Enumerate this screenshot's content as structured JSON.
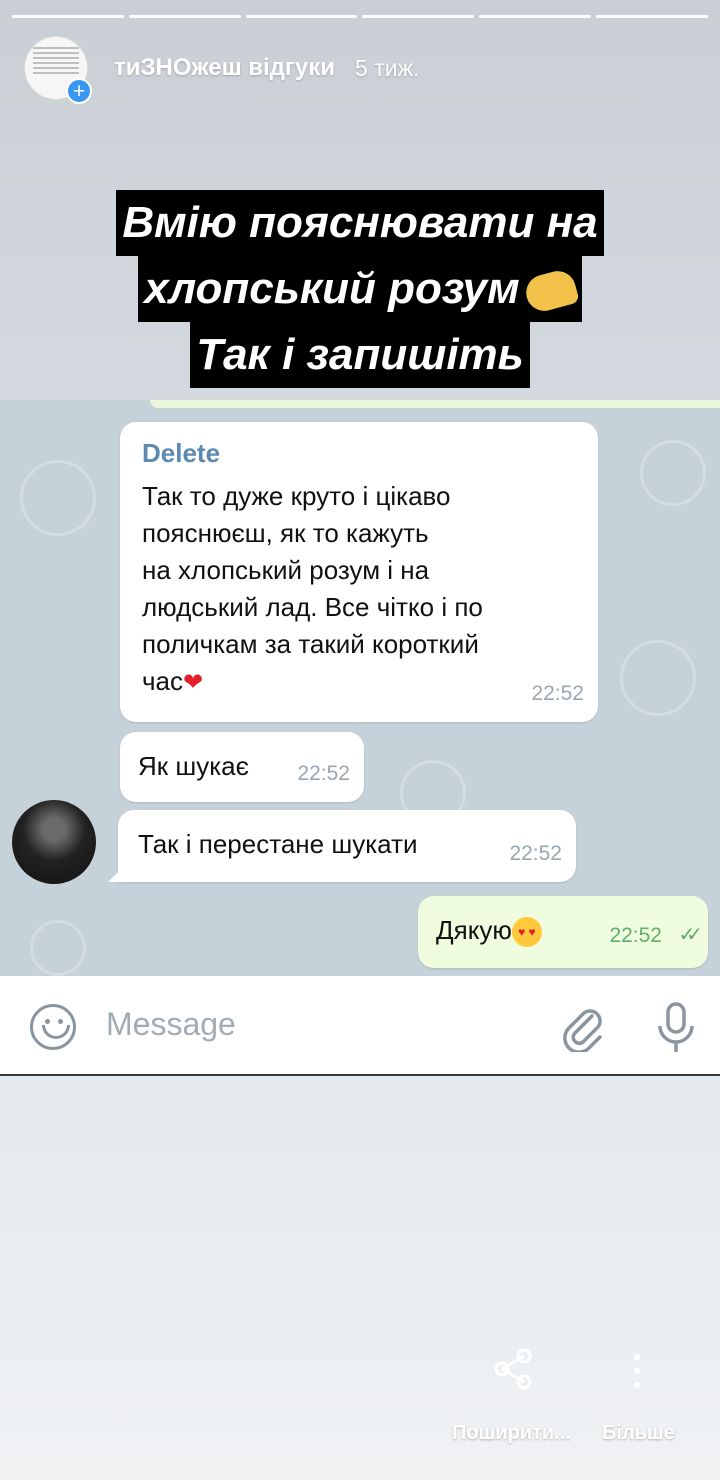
{
  "story": {
    "segments": 6,
    "username": "тиЗНОжеш відгуки",
    "time": "5 тиж.",
    "caption": [
      "Вмію пояснювати на",
      "хлопський розум",
      "Так і запишіть"
    ],
    "caption_emoji": "flexed-biceps"
  },
  "chat": {
    "messages": [
      {
        "sender": "Delete",
        "text": "Так то дуже круто і цікаво\nпояснюєш, як то кажуть\nна хлопський розум і на\nлюдський лад. Все чітко і по\nполичкам за такий короткий\nчас",
        "emoji": "red-heart",
        "time": "22:52"
      },
      {
        "text": "Як шукає",
        "time": "22:52"
      },
      {
        "text": "Так і перестане шукати",
        "time": "22:52"
      },
      {
        "text": "Дякую",
        "emoji": "heart-eyes-face",
        "time": "22:52",
        "outgoing": true,
        "read": true
      }
    ],
    "placeholder": "Message"
  },
  "actions": {
    "share": "Поширити...",
    "more": "Більше"
  },
  "colors": {
    "caption_bg": "#000000",
    "chat_bg": "#c6d2d9",
    "outgoing_bubble": "#effdde",
    "sender": "#5c8ab1",
    "read_check": "#5fae6d",
    "badge": "#3897f0"
  }
}
